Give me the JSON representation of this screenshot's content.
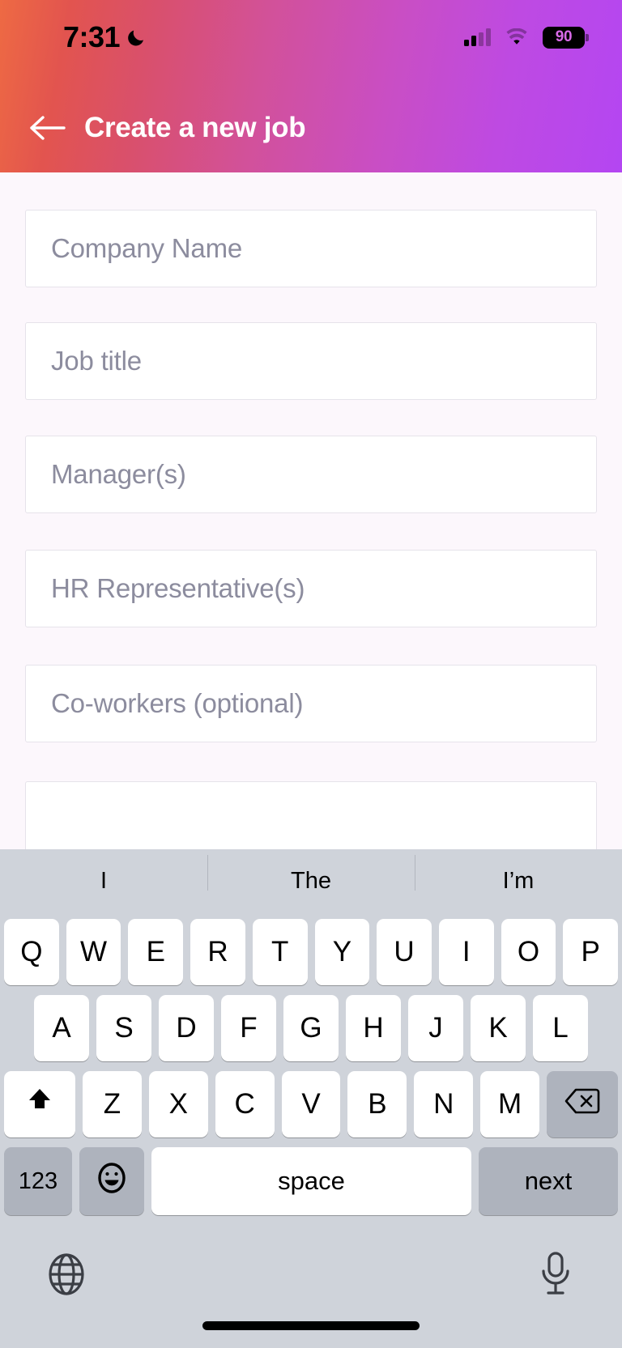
{
  "statusbar": {
    "time": "7:31",
    "moon_icon": "crescent-moon-icon",
    "cellular_icon": "cellular-signal-icon",
    "wifi_icon": "wifi-icon",
    "battery_level": "90",
    "battery_icon": "battery-icon"
  },
  "header": {
    "back_icon": "back-arrow-icon",
    "title": "Create a new job",
    "gradient_start": "#EE6A43",
    "gradient_mid": "#D2519A",
    "gradient_end": "#B446F2"
  },
  "form": {
    "background": "#FCF7FC",
    "field_border": "#E6E3EA",
    "placeholder_color": "#8C8C9E",
    "fields": [
      {
        "name": "company-name",
        "placeholder": "Company Name",
        "value": ""
      },
      {
        "name": "job-title",
        "placeholder": "Job title",
        "value": ""
      },
      {
        "name": "managers",
        "placeholder": "Manager(s)",
        "value": ""
      },
      {
        "name": "hr-representatives",
        "placeholder": "HR Representative(s)",
        "value": ""
      },
      {
        "name": "co-workers",
        "placeholder": "Co-workers (optional)",
        "value": ""
      },
      {
        "name": "next-field",
        "placeholder": "",
        "value": ""
      }
    ]
  },
  "keyboard": {
    "background": "#CFD3DA",
    "suggestions": [
      "I",
      "The",
      "I’m"
    ],
    "row1": [
      "Q",
      "W",
      "E",
      "R",
      "T",
      "Y",
      "U",
      "I",
      "O",
      "P"
    ],
    "row2": [
      "A",
      "S",
      "D",
      "F",
      "G",
      "H",
      "J",
      "K",
      "L"
    ],
    "row3_letters": [
      "Z",
      "X",
      "C",
      "V",
      "B",
      "N",
      "M"
    ],
    "shift_icon": "shift-arrow-icon",
    "backspace_icon": "backspace-icon",
    "numbers_label": "123",
    "emoji_icon": "emoji-smiley-icon",
    "space_label": "space",
    "return_label": "next",
    "globe_icon": "globe-icon",
    "mic_icon": "microphone-icon"
  }
}
